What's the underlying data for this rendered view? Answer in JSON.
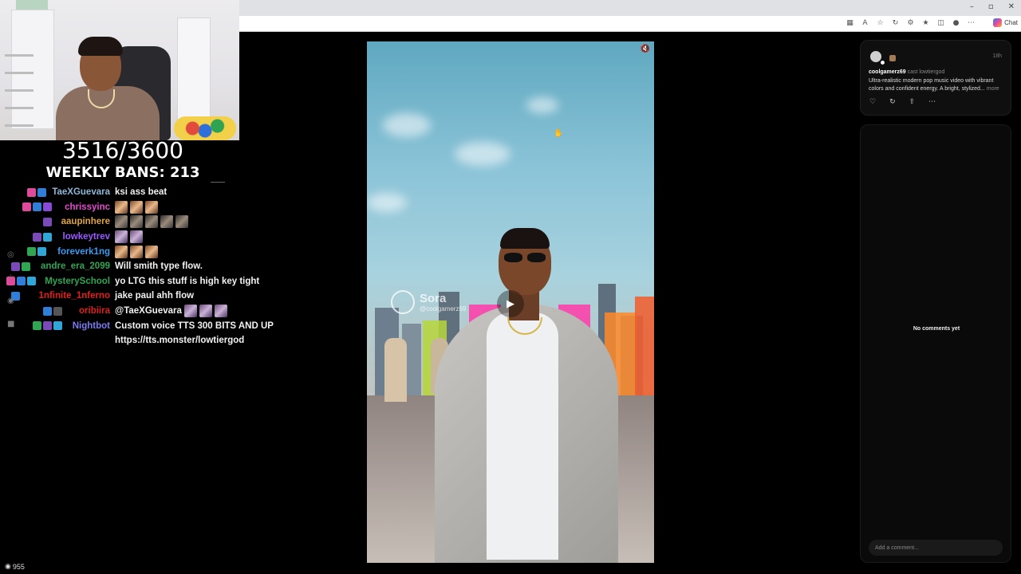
{
  "stream_overlay": {
    "ban_counter": "3516/3600",
    "weekly_bans": "WEEKLY BANS: 213",
    "viewer_count": "955"
  },
  "chat": {
    "messages": [
      {
        "user": "TaeXGuevara",
        "color": "#8fb8d8",
        "text": "ksi ass beat",
        "badges": [
          "#e04a9a",
          "#2f7fd8"
        ],
        "emotes": []
      },
      {
        "user": "chrissyinc",
        "color": "#e64ad0",
        "text": "",
        "badges": [
          "#e04a9a",
          "#2f7fd8",
          "#8a4ad8"
        ],
        "emotes": [
          "a",
          "a",
          "a"
        ]
      },
      {
        "user": "aaupinhere",
        "color": "#e0a43a",
        "text": "",
        "badges": [
          "#7a4ab8"
        ],
        "emotes": [
          "b",
          "b",
          "b",
          "b",
          "b"
        ]
      },
      {
        "user": "lowkeytrev",
        "color": "#9a5aff",
        "text": "",
        "badges": [
          "#7a4ab8",
          "#2fa6d8"
        ],
        "emotes": [
          "c",
          "c"
        ]
      },
      {
        "user": "foreverk1ng",
        "color": "#3a9af0",
        "text": "",
        "badges": [
          "#2fa652",
          "#2fa6d8"
        ],
        "emotes": [
          "a",
          "a",
          "a"
        ]
      },
      {
        "user": "andre_era_2099",
        "color": "#2fa652",
        "text": "Will smith type flow.",
        "badges": [
          "#7a4ab8",
          "#2fa652"
        ],
        "emotes": []
      },
      {
        "user": "MysterySchool",
        "color": "#2fa652",
        "text": "yo LTG this stuff is high key tight",
        "badges": [
          "#e04a9a",
          "#2f7fd8",
          "#2fa6d8"
        ],
        "emotes": []
      },
      {
        "user": "1nfinite_1nferno",
        "color": "#e02020",
        "text": "jake paul ahh flow",
        "badges": [
          "#2f7fd8"
        ],
        "emotes": []
      },
      {
        "user": "oribiira",
        "color": "#e02020",
        "text": "@TaeXGuevara",
        "badges": [
          "#2f7fd8",
          "#555555"
        ],
        "emotes": [
          "c",
          "c",
          "c"
        ]
      },
      {
        "user": "Nightbot",
        "color": "#7a7af0",
        "text": "Custom voice TTS 300 BITS AND UP",
        "badges": [
          "#2fa652",
          "#7a4ab8",
          "#2fa6d8"
        ],
        "emotes": []
      }
    ],
    "continuation": "https://tts.monster/lowtiergod"
  },
  "video": {
    "watermark_name": "Sora",
    "watermark_handle": "@coolgamerz69",
    "play_icon": "play-icon",
    "mute_icon": "muted-speaker-icon"
  },
  "post": {
    "author": "coolgamerz69",
    "cast": "cast lowtiergod",
    "time": "18h",
    "description": "Ultra-realistic modern pop music video with vibrant colors and confident energy. A bright, stylized...",
    "more_label": "more"
  },
  "comments": {
    "empty_text": "No comments yet",
    "input_placeholder": "Add a comment..."
  },
  "browser": {
    "chat_label": "Chat"
  }
}
